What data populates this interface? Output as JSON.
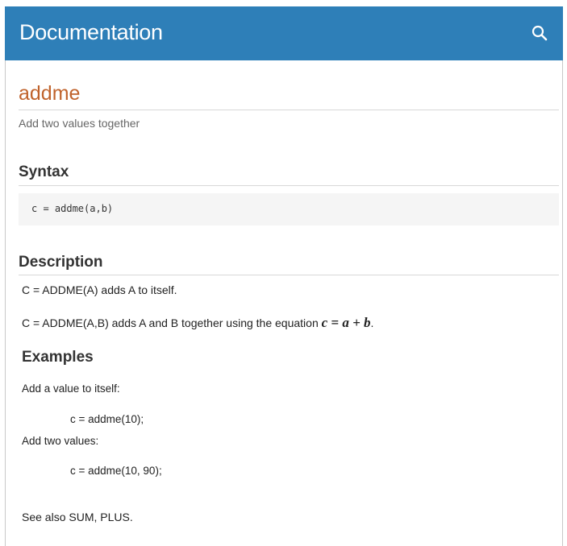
{
  "header": {
    "title": "Documentation",
    "search_icon": "search-icon"
  },
  "page": {
    "function_name": "addme",
    "purpose": "Add two values together"
  },
  "syntax": {
    "heading": "Syntax",
    "code": "c = addme(a,b)"
  },
  "description": {
    "heading": "Description",
    "line1": "C = ADDME(A) adds A to itself.",
    "line2_text": "C = ADDME(A,B) adds A and B together using the equation",
    "line2_equation": "c = a + b",
    "line2_end": "."
  },
  "examples": {
    "heading": "Examples",
    "ex1_label": "Add a value to itself:",
    "ex1_code": "c = addme(10);",
    "ex2_label": "Add two values:",
    "ex2_code": "c = addme(10, 90);"
  },
  "see_also": {
    "prefix": "See also",
    "link1": "SUM",
    "separator": ",",
    "link2": "PLUS",
    "suffix": "."
  },
  "colors": {
    "header_bg": "#2e7fb8",
    "function_name": "#c0632c"
  }
}
